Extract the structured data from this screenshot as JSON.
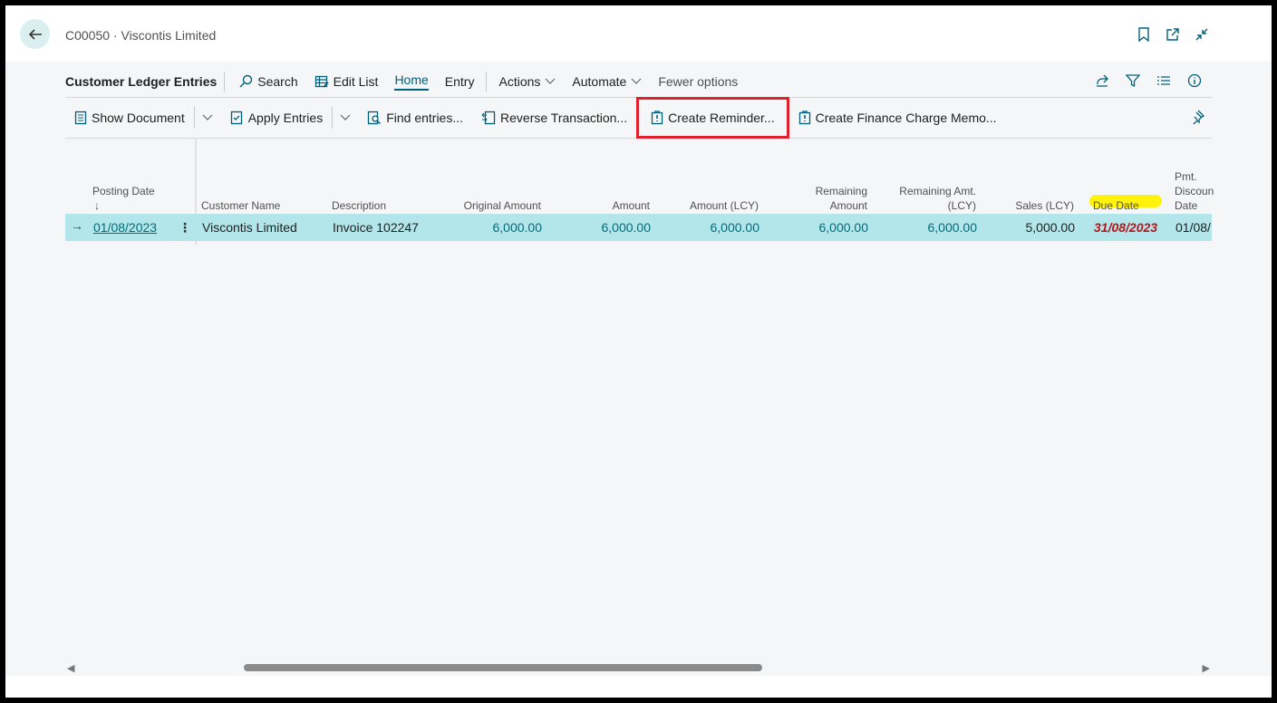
{
  "header": {
    "caption": "C00050 · Viscontis Limited"
  },
  "actionbar": {
    "title": "Customer Ledger Entries",
    "search": "Search",
    "edit_list": "Edit List",
    "home": "Home",
    "entry": "Entry",
    "actions": "Actions",
    "automate": "Automate",
    "fewer_options": "Fewer options"
  },
  "promoted": {
    "show_document": "Show Document",
    "apply_entries": "Apply Entries",
    "find_entries": "Find entries...",
    "reverse_transaction": "Reverse Transaction...",
    "create_reminder": "Create Reminder...",
    "create_finance_charge_memo": "Create Finance Charge Memo..."
  },
  "columns": {
    "posting_date": "Posting Date",
    "sort_arrow": "↓",
    "customer_name": "Customer Name",
    "description": "Description",
    "original_amount": "Original Amount",
    "amount": "Amount",
    "amount_lcy": "Amount (LCY)",
    "remaining_amount_1": "Remaining",
    "remaining_amount_2": "Amount",
    "remaining_amt_lcy_1": "Remaining Amt.",
    "remaining_amt_lcy_2": "(LCY)",
    "sales_lcy": "Sales (LCY)",
    "due_date": "Due Date",
    "pmt_discount_date_1": "Pmt.",
    "pmt_discount_date_2": "Discoun",
    "pmt_discount_date_3": "Date"
  },
  "row": {
    "row_arrow": "→",
    "posting_date": "01/08/2023",
    "menu_glyph": "⋮",
    "customer_name": "Viscontis Limited",
    "description": "Invoice 102247",
    "original_amount": "6,000.00",
    "amount": "6,000.00",
    "amount_lcy": "6,000.00",
    "remaining_amount": "6,000.00",
    "remaining_amt_lcy": "6,000.00",
    "sales_lcy": "5,000.00",
    "due_date": "31/08/2023",
    "pmt_discount_date": "01/08/"
  },
  "scrollbar": {
    "left_arrow": "◀",
    "right_arrow": "▶"
  },
  "colors": {
    "accent": "#00607a",
    "row_selected": "#b2e6ea",
    "highlight_box": "#e0202a",
    "marker": "#fff200",
    "overdue": "#b4161b"
  },
  "icons": [
    "back-arrow-icon",
    "bookmark-icon",
    "open-new-window-icon",
    "collapse-icon",
    "search-icon",
    "edit-list-icon",
    "share-icon",
    "filter-icon",
    "list-icon",
    "info-icon",
    "document-icon",
    "apply-icon",
    "find-icon",
    "reverse-icon",
    "reminder-icon",
    "finance-memo-icon",
    "pin-icon"
  ]
}
